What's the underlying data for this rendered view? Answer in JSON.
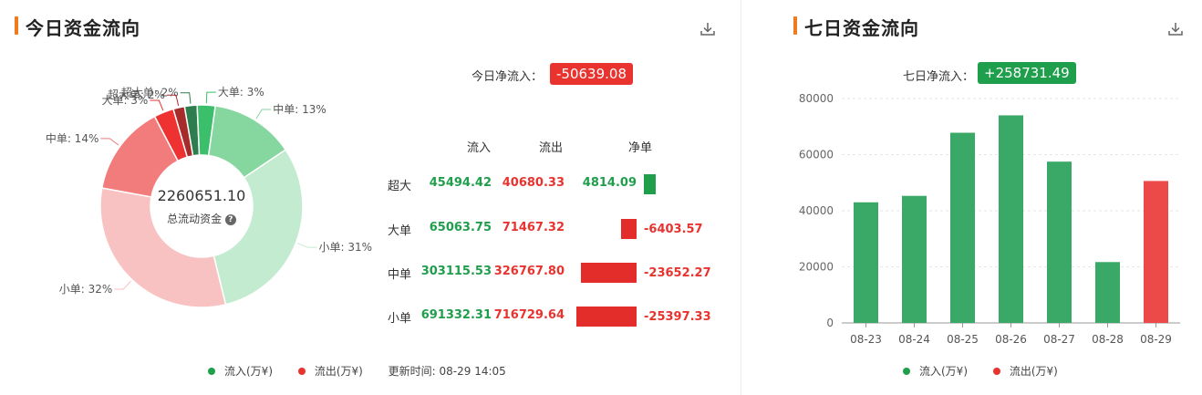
{
  "left": {
    "title": "今日资金流向",
    "net_label": "今日净流入：",
    "net_value": "-50639.08",
    "donut": {
      "center_value": "2260651.10",
      "center_label": "总流动资金",
      "help_icon": "question-circle-icon"
    },
    "table": {
      "headers": [
        "流入",
        "流出",
        "净单"
      ],
      "rows": [
        {
          "label": "超大",
          "inflow": "45494.42",
          "outflow": "40680.33",
          "net": "4814.09"
        },
        {
          "label": "大单",
          "inflow": "65063.75",
          "outflow": "71467.32",
          "net": "-6403.57"
        },
        {
          "label": "中单",
          "inflow": "303115.53",
          "outflow": "326767.80",
          "net": "-23652.27"
        },
        {
          "label": "小单",
          "inflow": "691332.31",
          "outflow": "716729.64",
          "net": "-25397.33"
        }
      ]
    },
    "legend": {
      "inflow": "流入(万¥)",
      "outflow": "流出(万¥)",
      "update": "更新时间: 08-29 14:05"
    }
  },
  "right": {
    "title": "七日资金流向",
    "net_label": "七日净流入：",
    "net_value": "+258731.49",
    "legend": {
      "inflow": "流入(万¥)",
      "outflow": "流出(万¥)"
    }
  },
  "colors": {
    "green": "#1f9e4c",
    "red": "#e8332f",
    "bar_green": "#3aa866",
    "bar_red": "#ec4a49",
    "accent": "#f07b1d"
  },
  "chart_data": [
    {
      "type": "pie",
      "variant": "donut",
      "slices": [
        {
          "label": "超大单: 2%",
          "value": 45494.42,
          "flow": "inflow",
          "color": "#2e7d4f"
        },
        {
          "label": "大单: 3%",
          "value": 65063.75,
          "flow": "inflow",
          "color": "#3cbf6a"
        },
        {
          "label": "中单: 13%",
          "value": 303115.53,
          "flow": "inflow",
          "color": "#86d6a0"
        },
        {
          "label": "小单: 31%",
          "value": 691332.31,
          "flow": "inflow",
          "color": "#c3ebd0"
        },
        {
          "label": "小单: 32%",
          "value": 716729.64,
          "flow": "outflow",
          "color": "#f8c2c2"
        },
        {
          "label": "中单: 14%",
          "value": 326767.8,
          "flow": "outflow",
          "color": "#f27b7b"
        },
        {
          "label": "大单: 3%",
          "value": 71467.32,
          "flow": "outflow",
          "color": "#ee3232"
        },
        {
          "label": "超大单: 2%",
          "value": 40680.33,
          "flow": "outflow",
          "color": "#a62b2b"
        }
      ]
    },
    {
      "type": "bar",
      "categories": [
        "08-23",
        "08-24",
        "08-25",
        "08-26",
        "08-27",
        "08-28",
        "08-29"
      ],
      "values": [
        43000,
        45300,
        67800,
        74000,
        57500,
        21700,
        50600
      ],
      "flow": [
        "inflow",
        "inflow",
        "inflow",
        "inflow",
        "inflow",
        "inflow",
        "outflow"
      ],
      "yticks": [
        "0",
        "20000",
        "40000",
        "60000",
        "80000"
      ],
      "ylim": [
        0,
        80000
      ],
      "grid": true
    }
  ]
}
